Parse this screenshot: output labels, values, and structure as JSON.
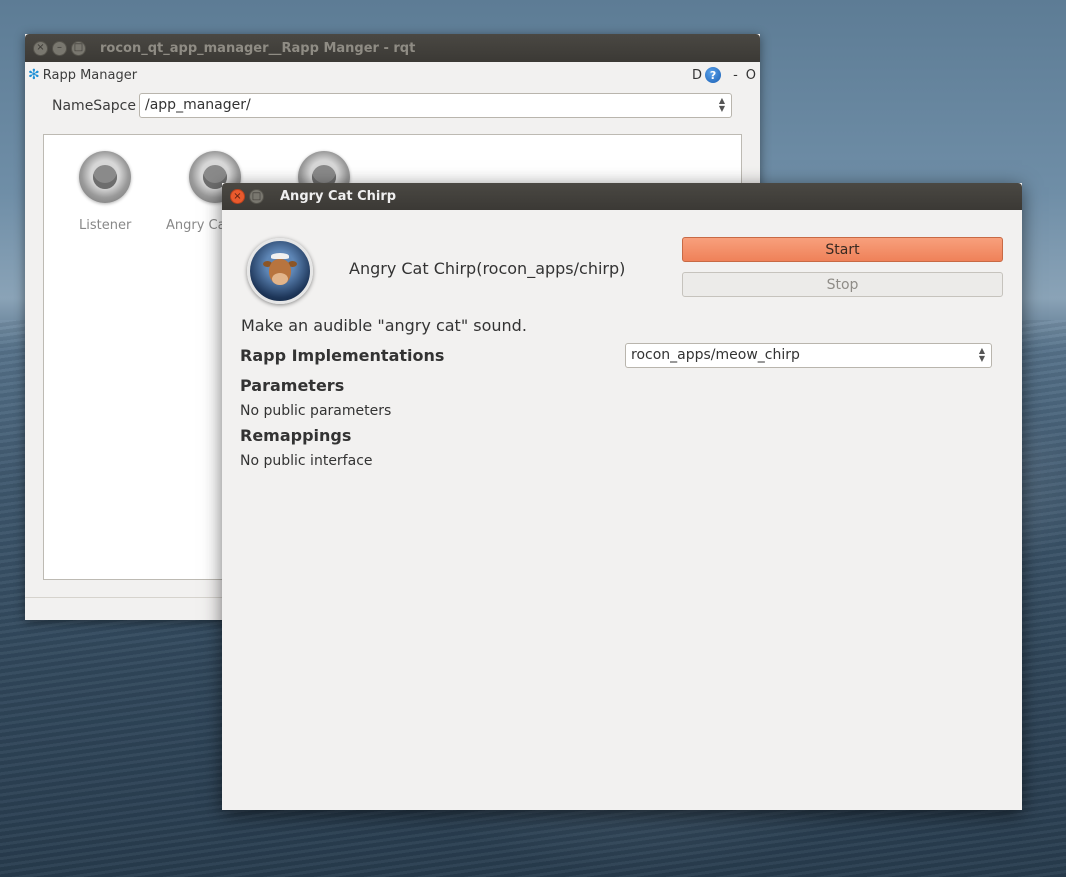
{
  "background_window": {
    "title": "rocon_qt_app_manager__Rapp Manger - rqt",
    "dock_title": "Rapp Manager",
    "dock_controls": {
      "d_label": "D",
      "help": "?",
      "minus": "-",
      "o_label": "O"
    },
    "namespace_label": "NameSapce",
    "namespace_value": "/app_manager/",
    "apps": [
      {
        "label": "Listener"
      },
      {
        "label": "Angry Ca"
      },
      {
        "label": ""
      }
    ]
  },
  "dialog": {
    "title": "Angry Cat Chirp",
    "rapp_display": "Angry Cat Chirp(rocon_apps/chirp)",
    "start_label": "Start",
    "stop_label": "Stop",
    "description": "Make an audible \"angry cat\" sound.",
    "implementations_title": "Rapp Implementations",
    "implementation_value": "rocon_apps/meow_chirp",
    "parameters_title": "Parameters",
    "parameters_text": "No public parameters",
    "remappings_title": "Remappings",
    "remappings_text": "No public interface"
  },
  "colors": {
    "start_button": "#ef8159",
    "titlebar": "#3b3935",
    "close_button": "#e95a2d"
  }
}
